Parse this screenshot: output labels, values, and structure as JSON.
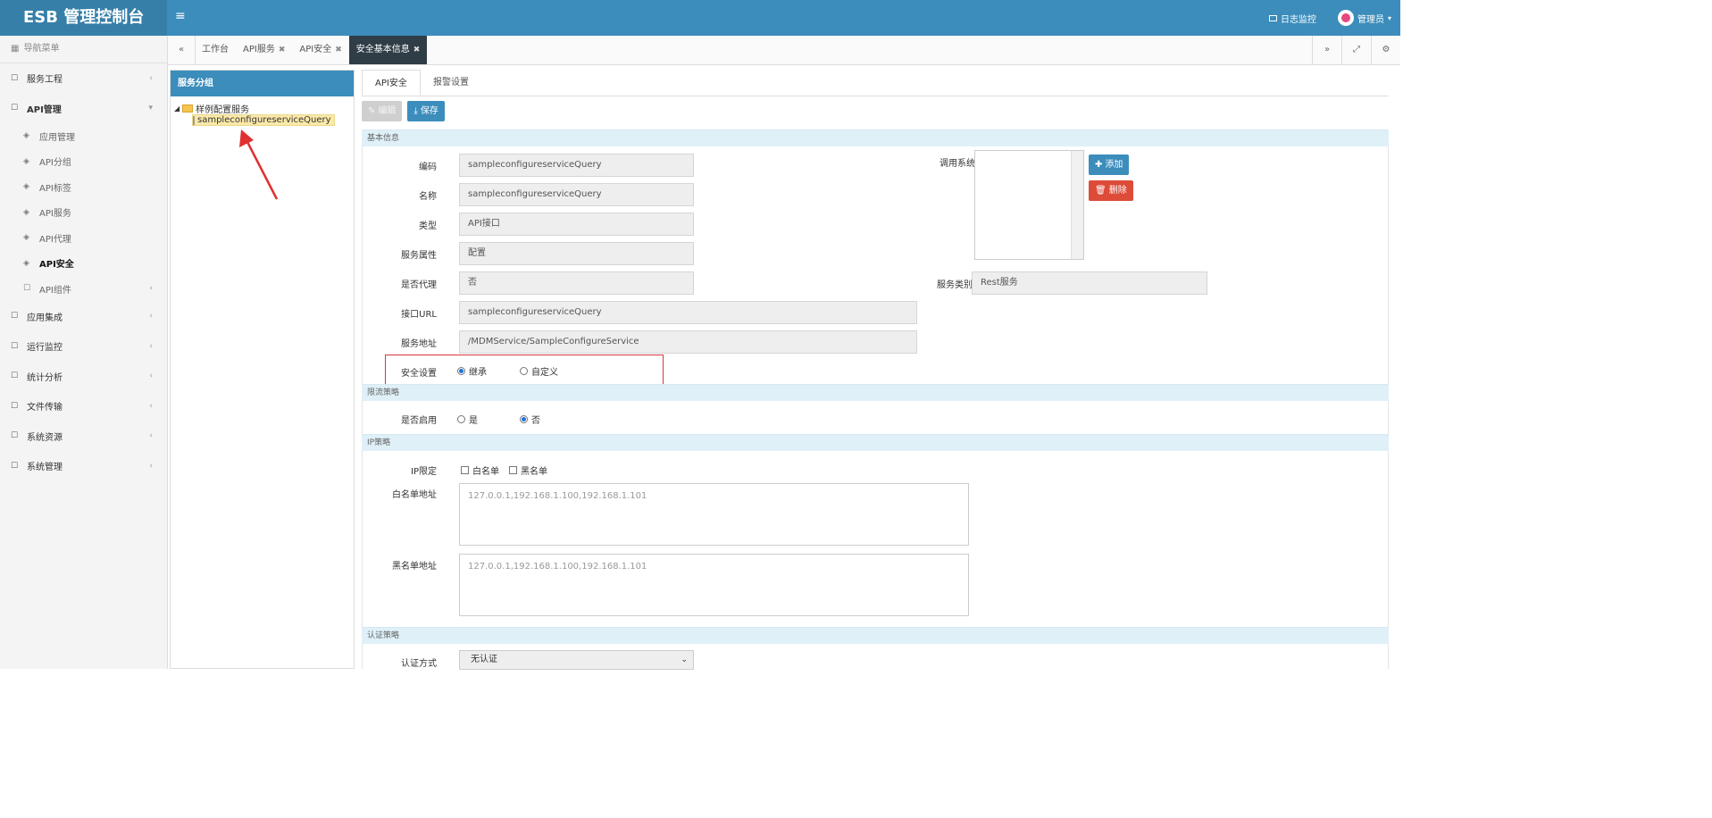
{
  "header": {
    "brand": "ESB 管理控制台",
    "menu_toggle": "≡",
    "log_monitor": "日志监控",
    "user": "管理员"
  },
  "sidebar": {
    "title": "导航菜单",
    "items": [
      {
        "label": "服务工程"
      },
      {
        "label": "API管理"
      },
      {
        "label": "应用管理"
      },
      {
        "label": "API分组"
      },
      {
        "label": "API标签"
      },
      {
        "label": "API服务"
      },
      {
        "label": "API代理"
      },
      {
        "label": "API安全"
      },
      {
        "label": "API组件"
      },
      {
        "label": "应用集成"
      },
      {
        "label": "运行监控"
      },
      {
        "label": "统计分析"
      },
      {
        "label": "文件传输"
      },
      {
        "label": "系统资源"
      },
      {
        "label": "系统管理"
      }
    ]
  },
  "tabbar": {
    "prev": "«",
    "next": "»",
    "tabs": [
      {
        "label": "工作台",
        "closable": false
      },
      {
        "label": "API服务",
        "closable": true
      },
      {
        "label": "API安全",
        "closable": true
      },
      {
        "label": "安全基本信息",
        "closable": true
      }
    ]
  },
  "service_panel": {
    "title": "服务分组",
    "tree_parent": "样例配置服务",
    "tree_child": "sampleconfigureserviceQuery"
  },
  "main": {
    "subtabs": [
      "API安全",
      "报警设置"
    ],
    "toolbar": {
      "edit": "编辑",
      "save": "保存"
    },
    "sections": {
      "basic": "基本信息",
      "flow": "限流策略",
      "ip": "IP策略",
      "auth": "认证策略"
    },
    "basic": {
      "code_label": "编码",
      "code_value": "sampleconfigureserviceQuery",
      "name_label": "名称",
      "name_value": "sampleconfigureserviceQuery",
      "type_label": "类型",
      "type_value": "API接口",
      "attr_label": "服务属性",
      "attr_value": "配置",
      "proxy_label": "是否代理",
      "proxy_value": "否",
      "url_label": "接口URL",
      "url_value": "sampleconfigureserviceQuery",
      "addr_label": "服务地址",
      "addr_value": "/MDMService/SampleConfigureService",
      "caller_label": "调用系统",
      "add_btn": "添加",
      "del_btn": "删除",
      "svc_type_label": "服务类别",
      "svc_type_value": "Rest服务",
      "security_label": "安全设置",
      "inherit": "继承",
      "custom": "自定义"
    },
    "flow": {
      "enable_label": "是否启用",
      "yes": "是",
      "no": "否"
    },
    "ip": {
      "limit_label": "IP限定",
      "whitelist": "白名单",
      "blacklist": "黑名单",
      "white_addr_label": "白名单地址",
      "white_placeholder": "127.0.0.1,192.168.1.100,192.168.1.101",
      "black_addr_label": "黑名单地址",
      "black_placeholder": "127.0.0.1,192.168.1.100,192.168.1.101"
    },
    "auth": {
      "method_label": "认证方式",
      "method_value": "无认证"
    }
  },
  "colors": {
    "primary": "#3c8dbc",
    "danger": "#dd4b39",
    "section_bg": "#dff0f8",
    "highlight_box": "#d9363e"
  }
}
